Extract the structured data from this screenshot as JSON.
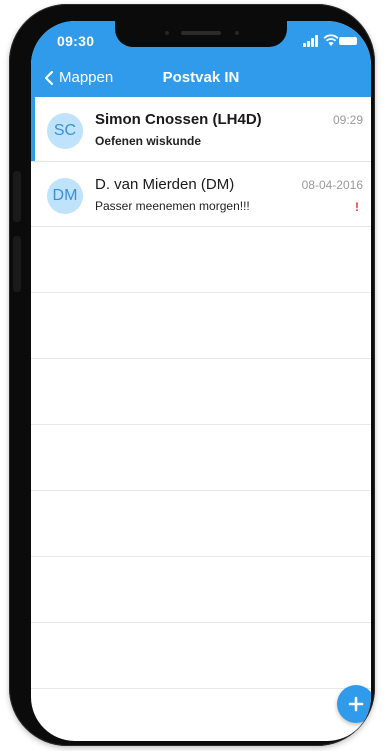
{
  "status_bar": {
    "time": "09:30",
    "icons": [
      "signal-icon",
      "wifi-icon",
      "battery-icon"
    ]
  },
  "nav": {
    "back_label": "Mappen",
    "title": "Postvak IN"
  },
  "messages": [
    {
      "initials": "SC",
      "sender": "Simon Cnossen (LH4D)",
      "subject": "Oefenen wiskunde",
      "time": "09:29",
      "unread": true,
      "selected": true,
      "flag": ""
    },
    {
      "initials": "DM",
      "sender": "D. van Mierden (DM)",
      "subject": "Passer meenemen morgen!!!",
      "time": "08-04-2016",
      "unread": false,
      "selected": false,
      "flag": "!"
    }
  ],
  "fab": {
    "icon": "plus-icon"
  },
  "colors": {
    "accent": "#2f9bea",
    "avatar_bg": "#bfe3fb",
    "flag": "#e53935"
  }
}
